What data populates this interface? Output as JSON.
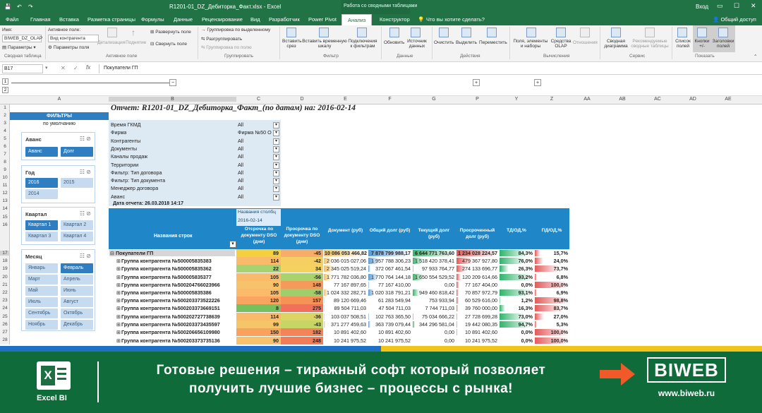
{
  "titlebar": {
    "title": "R1201-01_DZ_Дебиторка_Факт.xlsx - Excel",
    "context_header": "Работа со сводными таблицами",
    "login": "Вход",
    "share": "Общий доступ"
  },
  "tabs": [
    "Файл",
    "Главная",
    "Вставка",
    "Разметка страницы",
    "Формулы",
    "Данные",
    "Рецензирование",
    "Вид",
    "Разработчик",
    "Power Pivot",
    "Анализ",
    "Конструктор"
  ],
  "tell_me": "Что вы хотите сделать?",
  "ribbon": {
    "name_label": "Имя:",
    "name_value": "BIWEB_DZ_OLAP",
    "params_btn": "Параметры",
    "group_pivot": "Сводная таблица",
    "active_field_label": "Активное поле:",
    "active_field_value": "Вид контрагента",
    "field_params": "Параметры поля",
    "drilldown": "Детализация",
    "drillup": "Поднятие",
    "expand": "Развернуть поле",
    "collapse": "Свернуть поле",
    "group_active": "Активное поле",
    "group_sel": "Группировка по выделенному",
    "ungroup": "Разгруппировать",
    "group_field": "Группировка по полю",
    "group_group": "Группировать",
    "insert_slicer": "Вставить срез",
    "insert_timeline": "Вставить временную шкалу",
    "filter_conn": "Подключения к фильтрам",
    "group_filter": "Фильтр",
    "refresh": "Обновить",
    "change_source": "Источник данных",
    "group_data": "Данные",
    "clear": "Очистить",
    "select": "Выделить",
    "move": "Переместить",
    "group_actions": "Действия",
    "fields_items": "Поля, элементы и наборы",
    "olap_tools": "Средства OLAP",
    "relations": "Отношения",
    "group_calc": "Вычисления",
    "pivot_chart": "Сводная диаграмма",
    "recommended": "Рекомендуемые сводные таблицы",
    "group_tools": "Сервис",
    "field_list": "Список полей",
    "buttons": "Кнопки +/-",
    "headers": "Заголовки полей",
    "group_show": "Показать"
  },
  "formula_bar": {
    "cell": "B17",
    "content": "Покупатели ГП"
  },
  "columns": [
    "A",
    "B",
    "C",
    "D",
    "E",
    "F",
    "G",
    "P",
    "Y",
    "Z",
    "AA",
    "AB",
    "AC",
    "AD",
    "AE"
  ],
  "rows": [
    "1",
    "2",
    "3",
    "4",
    "5",
    "6",
    "7",
    "8",
    "9",
    "10",
    "11",
    "12",
    "13",
    "14",
    "15",
    "16",
    "17",
    "18",
    "19",
    "20",
    "21",
    "22",
    "23",
    "24",
    "25",
    "26",
    "27",
    "28"
  ],
  "slicers": {
    "header": "ФИЛЬТРЫ",
    "subheader": "по умолчанию",
    "avans": {
      "title": "Аванс",
      "items": [
        "Аванс",
        "Долг"
      ]
    },
    "year": {
      "title": "Год",
      "items": [
        "2016",
        "2015",
        "2014"
      ]
    },
    "quarter": {
      "title": "Квартал",
      "items": [
        "Квартал 1",
        "Квартал 2",
        "Квартал 3",
        "Квартал 4"
      ]
    },
    "month": {
      "title": "Месяц",
      "items": [
        "Январь",
        "Февраль",
        "Март",
        "Апрель",
        "Май",
        "Июнь",
        "Июль",
        "Август",
        "Сентябрь",
        "Октябрь",
        "Ноябрь",
        "Декабрь"
      ]
    }
  },
  "report": {
    "title": "Отчет: R1201-01_DZ_Дебиторка_Факт_(по датам) на: 2016-02-14",
    "filters": [
      {
        "name": "Время ГКМД",
        "value": "All"
      },
      {
        "name": "Фирма",
        "value": "Фирма №50 О"
      },
      {
        "name": "Контрагенты",
        "value": "All"
      },
      {
        "name": "Документы",
        "value": "All"
      },
      {
        "name": "Каналы продаж",
        "value": "All"
      },
      {
        "name": "Территории",
        "value": "All"
      },
      {
        "name": "Фильтр: Тип договора",
        "value": "All"
      },
      {
        "name": "Фильтр: Тип документа",
        "value": "All"
      },
      {
        "name": "Менеджер договора",
        "value": "All"
      },
      {
        "name": "Аванс",
        "value": "All"
      }
    ],
    "report_date": "Дата отчета: 26.03.2018 14:17",
    "col_labels": "Названия столбц",
    "date": "2016-02-14",
    "row_labels": "Названия строк",
    "headers": [
      "Отсрочка по документу DSO (дни)",
      "Просрочка по документу DSO (дни)",
      "Документ (руб)",
      "Общий долг (руб)",
      "Текущий долг (руб)",
      "Просроченный долг (руб)",
      "ТД/ОД,%",
      "ПД/ОД,%"
    ],
    "rows": [
      {
        "name": "Покупатели ГП",
        "c": "89",
        "d": "-45",
        "e": "10 086 053 466,82",
        "f": "7 878 799 988,17",
        "g": "6 644 771 763,60",
        "p": "1 234 028 224,57",
        "y": "84,3%",
        "z": "15,7%",
        "td": 0.843,
        "pd": 0.157,
        "cbg": "#f4d03f",
        "dbg": "#f7ad6a"
      },
      {
        "name": "Группа контрагента №500005835383",
        "c": "114",
        "d": "-42",
        "e": "2 036 015 027,06",
        "f": "1 957 788 306,23",
        "g": "1 518 420 378,41",
        "p": "479 367 927,80",
        "y": "76,0%",
        "z": "24,0%",
        "td": 0.76,
        "pd": 0.24,
        "cbg": "#f9bb69",
        "dbg": "#f6cf62"
      },
      {
        "name": "Группа контрагента №500005835362",
        "c": "22",
        "d": "34",
        "e": "2 345 025 519,24",
        "f": "372 067 461,54",
        "g": "97 933 764,77",
        "p": "274 133 696,77",
        "y": "26,3%",
        "z": "73,7%",
        "td": 0.263,
        "pd": 0.737,
        "cbg": "#a6d36f",
        "dbg": "#f5d25f"
      },
      {
        "name": "Группа контрагента №500005835377",
        "c": "105",
        "d": "-56",
        "e": "1 771 782 036,80",
        "f": "1 770 764 144,18",
        "g": "1 650 554 529,52",
        "p": "120 209 614,66",
        "y": "93,2%",
        "z": "6,8%",
        "td": 0.932,
        "pd": 0.068,
        "cbg": "#f9bb69",
        "dbg": "#a9d36a"
      },
      {
        "name": "Группа контрагента №500204766023966",
        "c": "90",
        "d": "148",
        "e": "77 167 897,65",
        "f": "77 167 410,00",
        "g": "0,00",
        "p": "77 167 404,00",
        "y": "0,0%",
        "z": "100,0%",
        "td": 0,
        "pd": 1.0,
        "cbg": "#f8c26c",
        "dbg": "#f69a5c"
      },
      {
        "name": "Группа контрагента №500005835386",
        "c": "105",
        "d": "-58",
        "e": "1 024 332 282,71",
        "f": "1 020 318 791,21",
        "g": "949 460 818,42",
        "p": "70 857 972,79",
        "y": "93,1%",
        "z": "6,9%",
        "td": 0.931,
        "pd": 0.069,
        "cbg": "#f9bb69",
        "dbg": "#9fce6b"
      },
      {
        "name": "Группа контрагента №500203373522226",
        "c": "120",
        "d": "157",
        "e": "89 120 669,46",
        "f": "61 283 549,94",
        "g": "753 933,94",
        "p": "60 529 616,00",
        "y": "1,2%",
        "z": "98,8%",
        "td": 0.012,
        "pd": 0.988,
        "cbg": "#f9a55f",
        "dbg": "#f79257"
      },
      {
        "name": "Группа контрагента №500203373669151",
        "c": "8",
        "d": "275",
        "e": "89 504 711,03",
        "f": "47 504 711,03",
        "g": "7 744 711,03",
        "p": "39 760 000,00",
        "y": "16,3%",
        "z": "83,7%",
        "td": 0.163,
        "pd": 0.837,
        "cbg": "#78bf5e",
        "dbg": "#f0705c"
      },
      {
        "name": "Группа контрагента №500202727738639",
        "c": "114",
        "d": "-36",
        "e": "103 037 508,51",
        "f": "102 763 365,50",
        "g": "75 034 666,22",
        "p": "27 728 699,28",
        "y": "73,0%",
        "z": "27,0%",
        "td": 0.73,
        "pd": 0.27,
        "cbg": "#f9bb69",
        "dbg": "#dcd563"
      },
      {
        "name": "Группа контрагента №500203373435597",
        "c": "99",
        "d": "-43",
        "e": "371 277 459,63",
        "f": "363 739 079,44",
        "g": "344 296 581,04",
        "p": "19 442 080,35",
        "y": "94,7%",
        "z": "5,3%",
        "td": 0.947,
        "pd": 0.053,
        "cbg": "#f5c56a",
        "dbg": "#c6d666"
      },
      {
        "name": "Группа контрагента №500206656109980",
        "c": "150",
        "d": "182",
        "e": "10 891 402,60",
        "f": "10 891 402,60",
        "g": "0,00",
        "p": "10 891 402,60",
        "y": "0,0%",
        "z": "100,0%",
        "td": 0,
        "pd": 1.0,
        "cbg": "#f8a25d",
        "dbg": "#f38458"
      },
      {
        "name": "Группа контрагента №500203373735136",
        "c": "90",
        "d": "248",
        "e": "10 241 975,52",
        "f": "10 241 975,52",
        "g": "0,00",
        "p": "10 241 975,52",
        "y": "0,0%",
        "z": "100,0%",
        "td": 0,
        "pd": 1.0,
        "cbg": "#f8c26c",
        "dbg": "#f27c58"
      }
    ]
  },
  "banner": {
    "logo_label": "Excel BI",
    "line1": "Готовые решения – тиражный софт который позволяет",
    "line2": "получить лучшие бизнес – процессы с рынка!",
    "brand": "BIWEB",
    "url": "www.biweb.ru"
  },
  "colors": {
    "excel_green": "#217346",
    "slicer_selected": "#2e7ec1",
    "pivot_header": "#1f86c8",
    "banner_bg": "#0f6b3a"
  }
}
